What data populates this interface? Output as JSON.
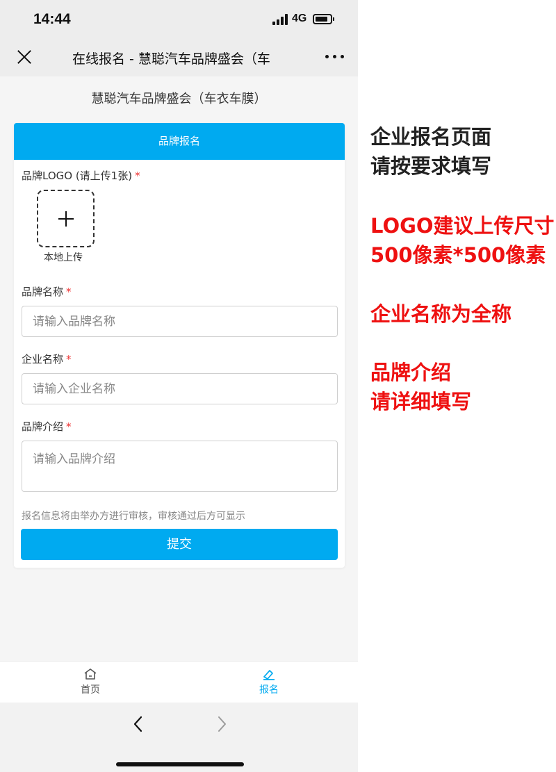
{
  "status_bar": {
    "time": "14:44",
    "network": "4G"
  },
  "nav_bar": {
    "title": "在线报名 - 慧聪汽车品牌盛会（车"
  },
  "page": {
    "heading": "慧聪汽车品牌盛会（车衣车膜）"
  },
  "form": {
    "header": "品牌报名",
    "logo_label": "品牌LOGO (请上传1张)",
    "upload_caption": "本地上传",
    "brand_name_label": "品牌名称",
    "brand_name_placeholder": "请输入品牌名称",
    "company_name_label": "企业名称",
    "company_name_placeholder": "请输入企业名称",
    "brand_intro_label": "品牌介绍",
    "brand_intro_placeholder": "请输入品牌介绍",
    "required_mark": "*",
    "notice": "报名信息将由举办方进行审核，审核通过后方可显示",
    "submit_label": "提交"
  },
  "tab_bar": {
    "items": [
      {
        "label": "首页",
        "icon": "home-icon",
        "active": false
      },
      {
        "label": "报名",
        "icon": "signup-icon",
        "active": true
      }
    ]
  },
  "annotations": {
    "line1": "企业报名页面",
    "line2": "请按要求填写",
    "line3": "LOGO建议上传尺寸",
    "line4": "500像素*500像素",
    "line5": "企业名称为全称",
    "line6": "品牌介绍",
    "line7": "请详细填写"
  },
  "colors": {
    "accent": "#00aaf0",
    "annotation_red": "#ee1111",
    "required": "#e33333"
  }
}
